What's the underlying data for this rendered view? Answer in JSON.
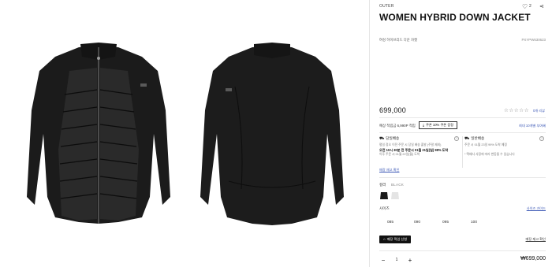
{
  "product": {
    "category": "OUTER",
    "title": "WOMEN HYBRID DOWN JACKET",
    "korean_name": "여성 하이브리드 다운 자켓",
    "code": "PXYPW630623",
    "price": "699,000",
    "rating_stars": "☆☆☆☆☆",
    "review_link": "0개 리뷰"
  },
  "header": {
    "wish_count": "2"
  },
  "benefits": {
    "points": "예상 적립금 6,990P 적립",
    "coupon_button": "쿠폰 10% 쿠폰 증정",
    "benefit_link": "최대 10개별 부여혜"
  },
  "shipping": {
    "left": {
      "title": "당일배송",
      "line1": "평일 정오 이전 주문 시 당일 배송 출발 (주말 제외)",
      "line2": "오전 10시 30분 전 주문시 01월 21일(일) 98% 도착",
      "line3": "이후 주문 시 01월 22일(월) 도착"
    },
    "right": {
      "title": "일반배송",
      "line1": "주문 시 01월 23일 99% 도착 예정",
      "line2": "",
      "line3": "* 택배사 사정에 따라 변동될 수 있습니다"
    },
    "store_link": "매장 재고 확인"
  },
  "options": {
    "color_label": "컬러",
    "color_value": "BLACK",
    "size_label": "사이즈",
    "size_guide": "사이즈 가이드",
    "sizes": [
      "085",
      "090",
      "095",
      "100"
    ]
  },
  "actions": {
    "store_button": "매장 픽업 신청",
    "stock_link": "매장 재고 확인"
  },
  "order": {
    "quantity": "1",
    "total": "₩699,000"
  },
  "colors": {
    "accent_link": "#3a56b5",
    "button_dark": "#111111"
  }
}
